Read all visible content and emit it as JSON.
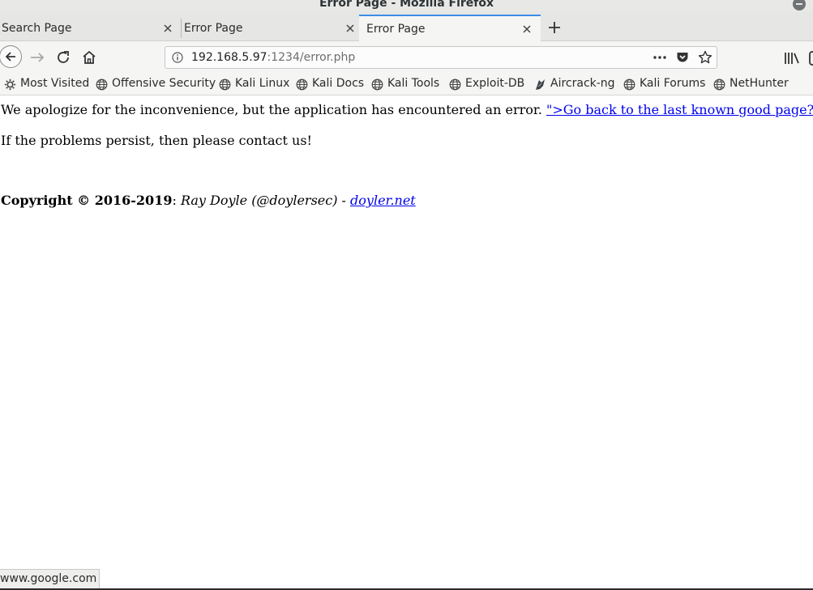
{
  "window": {
    "title": "Error Page - Mozilla Firefox"
  },
  "tabs": [
    {
      "label": "Search Page",
      "active": false
    },
    {
      "label": "Error Page",
      "active": false
    },
    {
      "label": "Error Page",
      "active": true
    }
  ],
  "address_bar": {
    "host": "192.168.5.97",
    "path": ":1234/error.php"
  },
  "bookmarks": [
    {
      "label": "Most Visited",
      "icon": "gear-icon"
    },
    {
      "label": "Offensive Security",
      "icon": "globe-icon"
    },
    {
      "label": "Kali Linux",
      "icon": "globe-icon"
    },
    {
      "label": "Kali Docs",
      "icon": "globe-icon"
    },
    {
      "label": "Kali Tools",
      "icon": "globe-icon"
    },
    {
      "label": "Exploit-DB",
      "icon": "globe-icon"
    },
    {
      "label": "Aircrack-ng",
      "icon": "aircrack-icon"
    },
    {
      "label": "Kali Forums",
      "icon": "globe-icon"
    },
    {
      "label": "NetHunter",
      "icon": "globe-icon"
    }
  ],
  "page": {
    "message": "We apologize for the inconvenience, but the application has encountered an error.",
    "back_link": "\">Go back to the last known good page?",
    "persist": "If the problems persist, then please contact us!",
    "copyright": "Copyright © 2016-2019",
    "colon": ": ",
    "author": "Ray Doyle (@doylersec) - ",
    "site_link": "doyler.net"
  },
  "status": {
    "url": "www.google.com"
  },
  "colors": {
    "active_tab_accent": "#3c8ee6",
    "link": "#0000ee"
  }
}
